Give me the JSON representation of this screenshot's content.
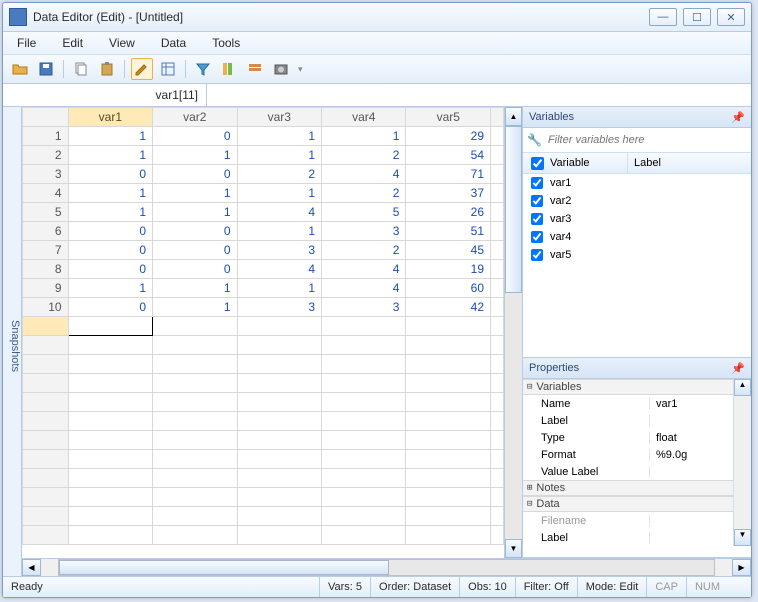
{
  "title": "Data Editor (Edit) - [Untitled]",
  "menu": {
    "file": "File",
    "edit": "Edit",
    "view": "View",
    "data": "Data",
    "tools": "Tools"
  },
  "formula": {
    "name": "var1[11]",
    "value": ""
  },
  "snapshots_label": "Snapshots",
  "columns": [
    "var1",
    "var2",
    "var3",
    "var4",
    "var5"
  ],
  "rows": [
    {
      "n": "1",
      "c": [
        "1",
        "0",
        "1",
        "1",
        "29"
      ]
    },
    {
      "n": "2",
      "c": [
        "1",
        "1",
        "1",
        "2",
        "54"
      ]
    },
    {
      "n": "3",
      "c": [
        "0",
        "0",
        "2",
        "4",
        "71"
      ]
    },
    {
      "n": "4",
      "c": [
        "1",
        "1",
        "1",
        "2",
        "37"
      ]
    },
    {
      "n": "5",
      "c": [
        "1",
        "1",
        "4",
        "5",
        "26"
      ]
    },
    {
      "n": "6",
      "c": [
        "0",
        "0",
        "1",
        "3",
        "51"
      ]
    },
    {
      "n": "7",
      "c": [
        "0",
        "0",
        "3",
        "2",
        "45"
      ]
    },
    {
      "n": "8",
      "c": [
        "0",
        "0",
        "4",
        "4",
        "19"
      ]
    },
    {
      "n": "9",
      "c": [
        "1",
        "1",
        "1",
        "4",
        "60"
      ]
    },
    {
      "n": "10",
      "c": [
        "0",
        "1",
        "3",
        "3",
        "42"
      ]
    }
  ],
  "variables_panel": {
    "title": "Variables",
    "filter_placeholder": "Filter variables here",
    "hdr_var": "Variable",
    "hdr_label": "Label",
    "items": [
      "var1",
      "var2",
      "var3",
      "var4",
      "var5"
    ]
  },
  "properties_panel": {
    "title": "Properties",
    "groups": {
      "variables": "Variables",
      "notes": "Notes",
      "data": "Data"
    },
    "keys": {
      "name": "Name",
      "label": "Label",
      "type": "Type",
      "format": "Format",
      "vlabel": "Value Label",
      "filename": "Filename",
      "dlabel": "Label"
    },
    "vals": {
      "name": "var1",
      "label": "",
      "type": "float",
      "format": "%9.0g",
      "vlabel": ""
    }
  },
  "status": {
    "ready": "Ready",
    "vars": "Vars: 5",
    "order": "Order: Dataset",
    "obs": "Obs: 10",
    "filter": "Filter: Off",
    "mode": "Mode: Edit",
    "cap": "CAP",
    "num": "NUM"
  }
}
